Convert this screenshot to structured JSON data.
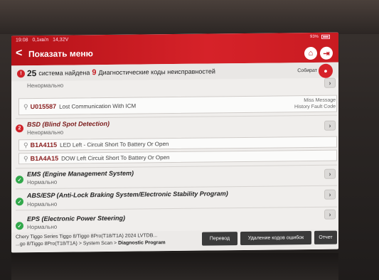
{
  "status_bar": {
    "time": "19:08",
    "speed": "0,1кв/л",
    "voltage": "14,32V",
    "battery": "93%"
  },
  "header": {
    "back": "<",
    "title": "Показать меню",
    "home_icon": "home-icon",
    "exit_icon": "exit-icon"
  },
  "summary": {
    "count_1": "25",
    "text_1": "система найдена",
    "count_2": "9",
    "text_2": "Диагностические коды неисправностей",
    "collect": "Собират"
  },
  "rows": [
    {
      "status": "Ненормально"
    },
    {
      "code": "U015587",
      "desc": "Lost Communication With ICM",
      "meta_1": "Miss Message",
      "meta_2": "History Fault Code"
    },
    {
      "index": "2",
      "name": "BSD (Blind Spot Detection)",
      "status": "Ненормально"
    },
    {
      "code": "B1A4115",
      "desc": "LED Left - Circuit Short To Battery Or Open"
    },
    {
      "code": "B1A4A15",
      "desc": "DOW Left Circuit Short To Battery Or Open"
    },
    {
      "name": "EMS (Engine Management System)",
      "status": "Нормально"
    },
    {
      "name": "ABS/ESP (Anti-Lock Braking System/Electronic Stability Program)",
      "status": "Нормально"
    },
    {
      "name": "EPS (Electronic Power Steering)",
      "status": "Нормально"
    }
  ],
  "bottom": {
    "vehicle_line_1": "Chery  Tiggo Series Tiggo 8/Tiggo 8Pro(T18/T1A) 2024  LVTDB...",
    "vehicle_line_2a": "...go 8/Tiggo 8Pro(T18/T1A) > System Scan > ",
    "vehicle_line_2b": "Diagnostic Program",
    "translate": "Перевод",
    "clear_codes": "Удаление кодов ошибок",
    "report": "Отчет"
  },
  "colors": {
    "accent": "#d62229",
    "ok": "#32a84b",
    "fault_text": "#8a1e1e"
  }
}
